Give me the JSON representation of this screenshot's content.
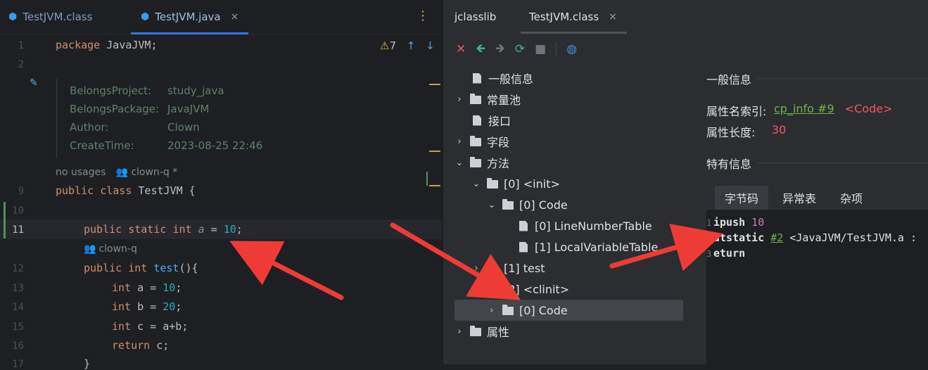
{
  "editor": {
    "tabs": [
      {
        "label": "TestJVM.class"
      },
      {
        "label": "TestJVM.java",
        "close": "×"
      }
    ],
    "menu_icon": "⋮",
    "inspection": {
      "count": "7"
    },
    "line_numbers": [
      "1",
      "2",
      "9",
      "10",
      "11",
      "12",
      "13",
      "14",
      "15",
      "16",
      "17"
    ],
    "code": {
      "l1_kw": "package",
      "l1_rest": " JavaJVM;",
      "l9_a": "public",
      "l9_b": "class",
      "l9_c": " TestJVM {",
      "l11_a": "public",
      "l11_b": "static",
      "l11_c": "int",
      "l11_d": "a",
      "l11_e": " = ",
      "l11_f": "10",
      "l11_g": ";",
      "l12_a": "public",
      "l12_b": "int",
      "l12_c": "test",
      "l12_d": "(){",
      "l13_a": "int",
      "l13_b": " a = ",
      "l13_c": "10",
      "l13_d": ";",
      "l14_a": "int",
      "l14_b": " b = ",
      "l14_c": "20",
      "l14_d": ";",
      "l15_a": "int",
      "l15_b": " c = a+b;",
      "l16_a": "return",
      "l16_b": " c;",
      "l17": "}"
    },
    "doc": [
      {
        "key": "BelongsProject:",
        "value": "study_java"
      },
      {
        "key": "BelongsPackage:",
        "value": "JavaJVM"
      },
      {
        "key": "Author:",
        "value": "Clown"
      },
      {
        "key": "CreateTime:",
        "value": "2023-08-25 22:46"
      }
    ],
    "hint1_usages": "no usages",
    "hint1_author": "clown-q *",
    "hint2_author": "clown-q"
  },
  "jclasslib": {
    "tab_app": "jclasslib",
    "tab_file": "TestJVM.class",
    "tab_close": "×",
    "tree": [
      {
        "label": "一般信息"
      },
      {
        "label": "常量池"
      },
      {
        "label": "接口"
      },
      {
        "label": "字段"
      },
      {
        "label": "方法"
      },
      {
        "label": "[0] <init>"
      },
      {
        "label": "[0] Code"
      },
      {
        "label": "[0] LineNumberTable"
      },
      {
        "label": "[1] LocalVariableTable"
      },
      {
        "label": "[1] test"
      },
      {
        "label": "[2] <clinit>"
      },
      {
        "label": "[0] Code"
      },
      {
        "label": "属性"
      }
    ],
    "general_title": "一般信息",
    "attr_name_label": "属性名索引:",
    "attr_name_link": "cp_info #9",
    "attr_name_value": "<Code>",
    "attr_len_label": "属性长度:",
    "attr_len_value": "30",
    "specific_title": "特有信息",
    "inner_tabs": [
      "字节码",
      "异常表",
      "杂项"
    ],
    "bytecode": [
      {
        "ln": "1",
        "op": "ipush",
        "arg": " 10"
      },
      {
        "ln": "2",
        "op": "utstatic",
        "ref": "#2",
        "rest": " <JavaJVM/TestJVM.a :"
      },
      {
        "ln": "3",
        "op": "eturn"
      }
    ]
  },
  "colors": {
    "accent": "#3574f0",
    "keyword": "#cf8e6d",
    "number": "#2aacb8",
    "arrow": "#ef3b36",
    "link": "#6fb34a",
    "value_red": "#f75464"
  }
}
